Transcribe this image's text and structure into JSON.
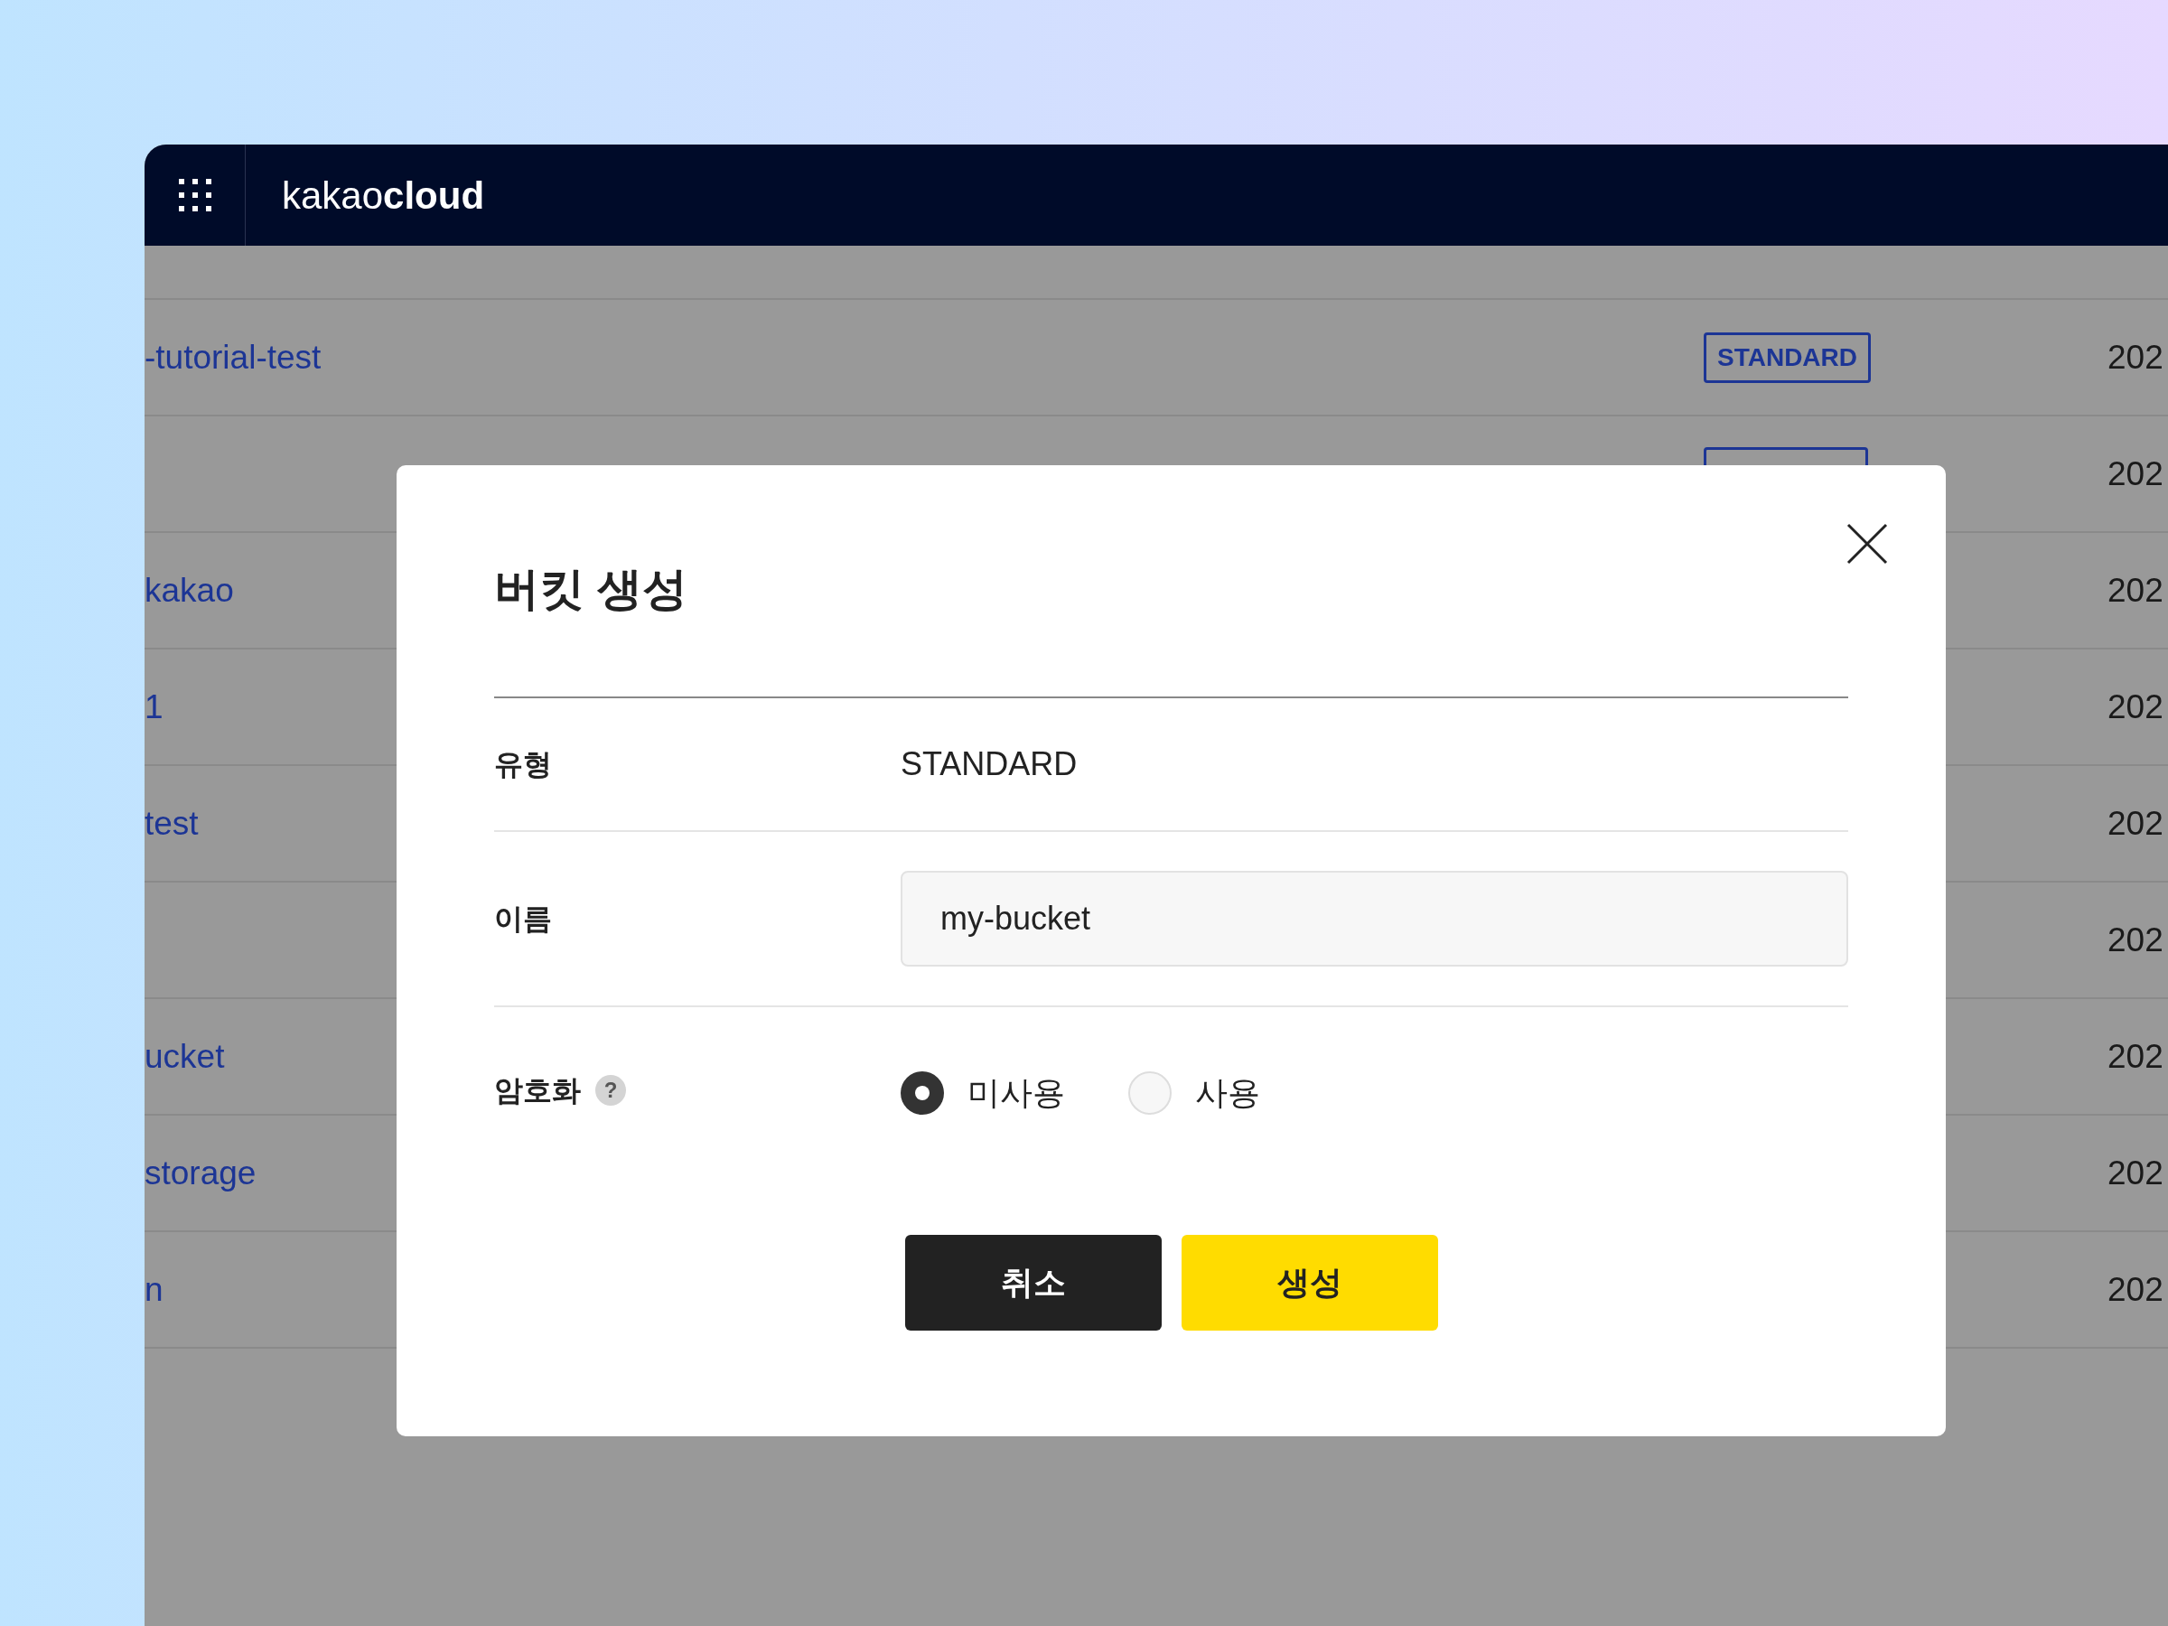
{
  "header": {
    "logo": "kakao**cloud**"
  },
  "table": {
    "rows": [
      {
        "name": "-tutorial-test",
        "type": "STANDARD",
        "created": "202"
      },
      {
        "has_tag": true,
        "created": "202"
      },
      {
        "name": "kakao",
        "created": "202"
      },
      {
        "name": "1",
        "created": "202"
      },
      {
        "name": "test",
        "created": "202"
      },
      {
        "created": "202"
      },
      {
        "name": "ucket",
        "created": "202"
      },
      {
        "name": "storage",
        "created": "202"
      },
      {
        "name": "n",
        "created": "202"
      }
    ]
  },
  "modal": {
    "title": "버킷 생성",
    "fields": [
      {
        "kind": "text",
        "label": "유형",
        "value": "STANDARD"
      },
      {
        "kind": "input",
        "label": "이름",
        "value": "my-bucket"
      },
      {
        "kind": "radio",
        "label": "암호화",
        "help": "?",
        "options": [
          {
            "label": "미사용",
            "selected": true
          },
          {
            "label": "사용",
            "selected": false
          }
        ]
      }
    ],
    "buttons": [
      {
        "kind": "secondary",
        "label": "취소"
      },
      {
        "kind": "primary",
        "label": "생성"
      }
    ]
  }
}
